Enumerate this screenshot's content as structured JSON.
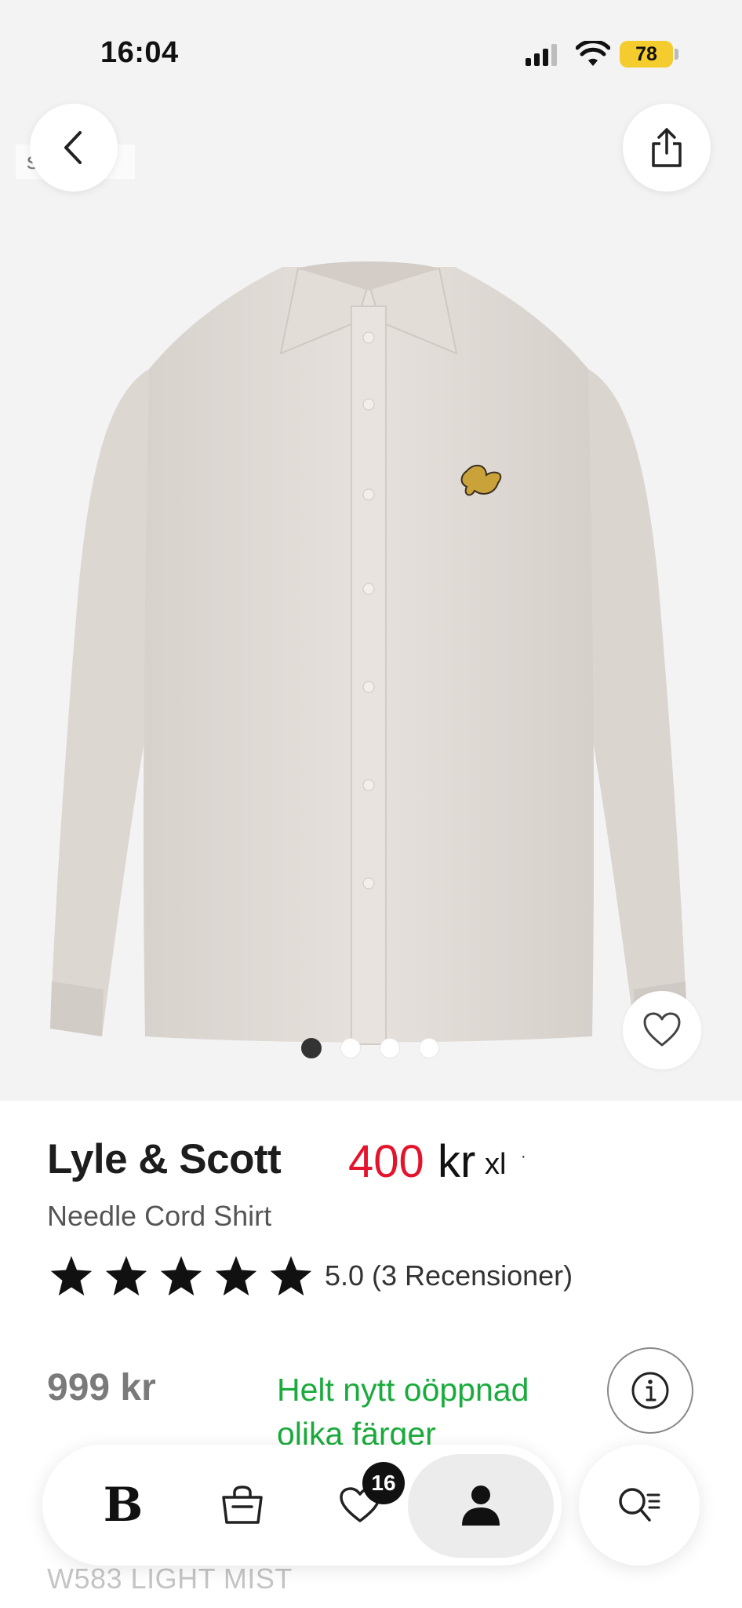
{
  "status_bar": {
    "time": "16:04",
    "battery": "78"
  },
  "image": {
    "sold_tag": "sold",
    "page_count": 4,
    "active_page": 1
  },
  "product": {
    "brand": "Lyle & Scott",
    "sale_price": "400",
    "currency": "kr",
    "size": "xl",
    "size_mark": "·",
    "name": "Needle Cord Shirt",
    "rating_stars": 5,
    "rating_text": "5.0 (3 Recensioner)",
    "original_price": "999 kr",
    "note": "Helt nytt oöppnad olika färger",
    "sku": "W583 LIGHT MIST"
  },
  "nav": {
    "favorites_count": "16"
  },
  "colors": {
    "sale_red": "#e3142c",
    "note_green": "#1aab3c",
    "battery_yellow": "#f5cc2d"
  },
  "icons": [
    "chevron-left-icon",
    "share-icon",
    "heart-icon",
    "info-icon",
    "home-logo-icon",
    "bag-icon",
    "profile-icon",
    "search-list-icon"
  ]
}
